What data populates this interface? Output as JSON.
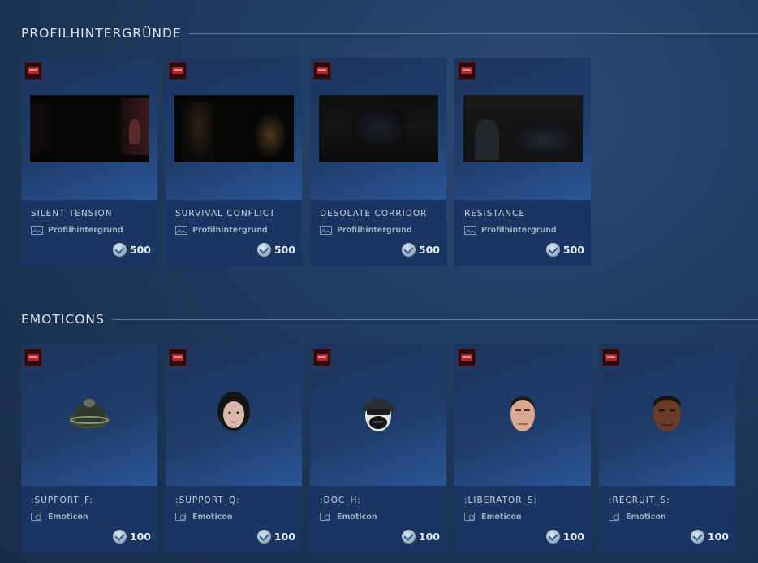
{
  "sections": {
    "backgrounds": {
      "title": "PROFILHINTERGRÜNDE",
      "items": [
        {
          "name": "SILENT TENSION",
          "type": "Profilhintergrund",
          "price": "500"
        },
        {
          "name": "SURVIVAL CONFLICT",
          "type": "Profilhintergrund",
          "price": "500"
        },
        {
          "name": "DESOLATE CORRIDOR",
          "type": "Profilhintergrund",
          "price": "500"
        },
        {
          "name": "RESISTANCE",
          "type": "Profilhintergrund",
          "price": "500"
        }
      ]
    },
    "emoticons": {
      "title": "EMOTICONS",
      "items": [
        {
          "name": ":SUPPORT_F:",
          "type": "Emoticon",
          "price": "100"
        },
        {
          "name": ":SUPPORT_Q:",
          "type": "Emoticon",
          "price": "100"
        },
        {
          "name": ":DOC_H:",
          "type": "Emoticon",
          "price": "100"
        },
        {
          "name": ":LIBERATOR_S:",
          "type": "Emoticon",
          "price": "100"
        },
        {
          "name": ":RECRUIT_S:",
          "type": "Emoticon",
          "price": "100"
        }
      ]
    }
  },
  "icons": {
    "app_badge": "game-logo-icon",
    "background_type": "image-landscape-icon",
    "emoticon_type": "emoticon-icon",
    "currency": "steam-points-coin-icon"
  },
  "colors": {
    "page_bg": "#1f3a5e",
    "card_bg": "#1c3964",
    "card_info_bg": "#1a3561",
    "badge_red": "#b4262b"
  }
}
